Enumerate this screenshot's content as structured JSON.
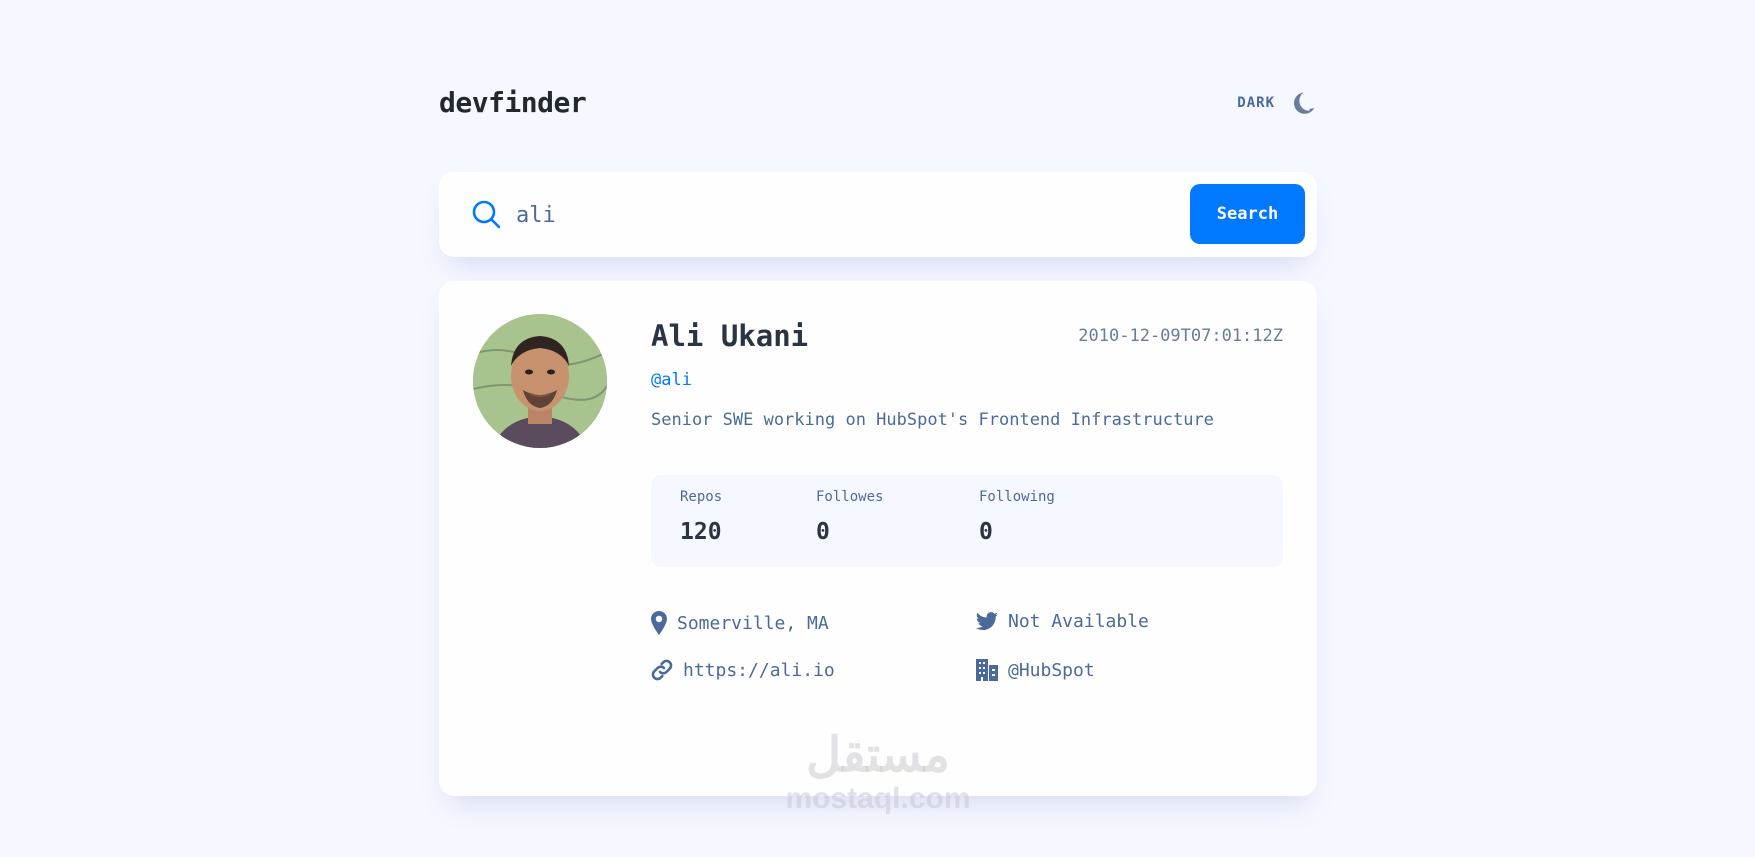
{
  "header": {
    "logo": "devfinder",
    "theme_label": "DARK",
    "theme_icon": "moon-icon"
  },
  "search": {
    "value": "ali",
    "placeholder": "",
    "button_label": "Search",
    "icon": "search-icon"
  },
  "profile": {
    "name": "Ali Ukani",
    "joined": "2010-12-09T07:01:12Z",
    "login": "@ali",
    "bio": "Senior SWE working on HubSpot's Frontend Infrastructure",
    "stats": [
      {
        "label": "Repos",
        "value": "120"
      },
      {
        "label": "Followes",
        "value": "0"
      },
      {
        "label": "Following",
        "value": "0"
      }
    ],
    "links": {
      "location": "Somerville, MA",
      "twitter": "Not Available",
      "website": "https://ali.io",
      "company": "@HubSpot"
    }
  },
  "watermark": {
    "arabic": "مستقل",
    "latin": "mostaql.com"
  },
  "colors": {
    "accent": "#0079ff",
    "background": "#f6f8ff",
    "card": "#fefefe",
    "text": "#4b6a9b",
    "heading": "#2b3442"
  }
}
